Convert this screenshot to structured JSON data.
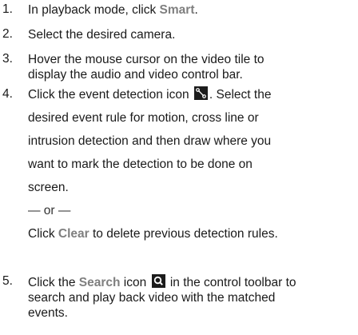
{
  "steps": [
    {
      "number": "1.",
      "text_before": "In playback mode, click ",
      "ui_term": "Smart",
      "text_after": "."
    },
    {
      "number": "2.",
      "text": "Select the desired camera."
    },
    {
      "number": "3.",
      "lines": [
        "Hover the mouse cursor on the video tile to",
        "display the audio and video control bar."
      ]
    },
    {
      "number": "4.",
      "line1_before": "Click the event detection icon ",
      "line1_after": ". Select the",
      "icon": "event-detection-icon",
      "lines": [
        "desired event rule for motion, cross line or",
        "intrusion detection and then draw where you",
        "want to mark the detection to be done on",
        "screen."
      ],
      "or": "— or —",
      "alt_before": "Click ",
      "alt_ui_term": "Clear",
      "alt_after": " to delete previous detection rules."
    },
    {
      "number": "5.",
      "line1_before": "Click the ",
      "ui_term": "Search",
      "line1_mid": " icon ",
      "icon": "search-icon",
      "line1_after": " in the control toolbar to",
      "lines": [
        "search and play back video with the matched",
        "events."
      ]
    }
  ]
}
